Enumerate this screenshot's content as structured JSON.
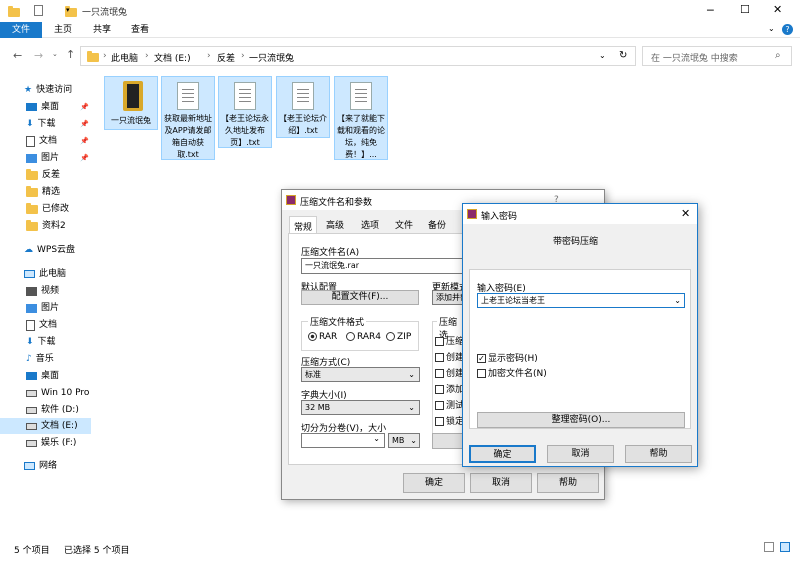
{
  "explorer": {
    "title": "一只流氓兔",
    "ribbon_tabs": [
      "文件",
      "主页",
      "共享",
      "查看"
    ],
    "breadcrumb": [
      "此电脑",
      "文档 (E:)",
      "反差",
      "一只流氓兔"
    ],
    "search_placeholder": "在 一只流氓兔 中搜索",
    "sidebar": [
      "快速访问",
      "桌面",
      "下载",
      "文档",
      "图片",
      "反差",
      "精选",
      "已修改",
      "资料2",
      "WPS云盘",
      "此电脑",
      "视频",
      "图片",
      "文档",
      "下载",
      "音乐",
      "桌面",
      "Win 10 Pro",
      "软件 (D:)",
      "文档 (E:)",
      "娱乐 (F:)",
      "网络"
    ],
    "files": [
      {
        "name": "一只流氓兔"
      },
      {
        "name": "获取最新地址及APP请发邮箱自动获取.txt"
      },
      {
        "name": "【老王论坛永久地址发布页】.txt"
      },
      {
        "name": "【老王论坛介绍】.txt"
      },
      {
        "name": "【来了就能下载和观看的论坛，纯免费！】..."
      }
    ],
    "status_count": "5 个项目",
    "status_selected": "已选择 5 个项目"
  },
  "archive_dialog": {
    "title": "压缩文件名和参数",
    "title_help": "?",
    "tabs": [
      "常规",
      "高级",
      "选项",
      "文件",
      "备份"
    ],
    "filename_label": "压缩文件名(A)",
    "filename_value": "一只流氓兔.rar",
    "default_profile_label": "默认配置",
    "profile_button": "配置文件(F)...",
    "update_mode_label": "更新模式",
    "update_mode_value": "添加并替",
    "format_label": "压缩文件格式",
    "formats": [
      "RAR",
      "RAR4",
      "ZIP"
    ],
    "options_label": "压缩选",
    "options": [
      "压缩",
      "创建",
      "创建",
      "添加",
      "测试",
      "锁定"
    ],
    "method_label": "压缩方式(C)",
    "method_value": "标准",
    "dict_label": "字典大小(I)",
    "dict_value": "32 MB",
    "split_label": "切分为分卷(V)，大小",
    "split_unit": "MB",
    "ok": "确定",
    "cancel": "取消",
    "help": "帮助"
  },
  "password_dialog": {
    "title": "输入密码",
    "heading": "带密码压缩",
    "input_label": "输入密码(E)",
    "input_value": "上老王论坛当老王",
    "show_password": "显示密码(H)",
    "encrypt_names": "加密文件名(N)",
    "organize_button": "整理密码(O)...",
    "ok": "确定",
    "cancel": "取消",
    "help": "帮助"
  }
}
